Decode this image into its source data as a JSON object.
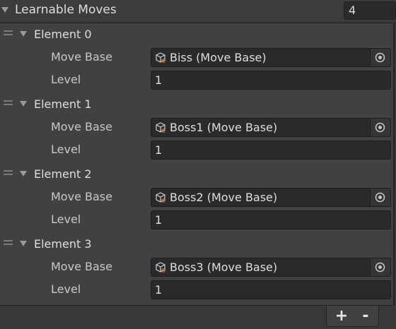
{
  "list": {
    "title": "Learnable Moves",
    "count": "4",
    "icons": {
      "fold": "triangle-down-icon",
      "drag": "drag-handle-icon",
      "asset": "scriptable-object-icon",
      "picker": "object-picker-icon"
    },
    "elements": [
      {
        "label": "Element 0",
        "move_label": "Move Base",
        "move_value": "Biss (Move Base)",
        "level_label": "Level",
        "level_value": "1"
      },
      {
        "label": "Element 1",
        "move_label": "Move Base",
        "move_value": "Boss1 (Move Base)",
        "level_label": "Level",
        "level_value": "1"
      },
      {
        "label": "Element 2",
        "move_label": "Move Base",
        "move_value": "Boss2 (Move Base)",
        "level_label": "Level",
        "level_value": "1"
      },
      {
        "label": "Element 3",
        "move_label": "Move Base",
        "move_value": "Boss3 (Move Base)",
        "level_label": "Level",
        "level_value": "1"
      }
    ]
  },
  "footer": {
    "add_label": "+",
    "remove_label": "-"
  }
}
